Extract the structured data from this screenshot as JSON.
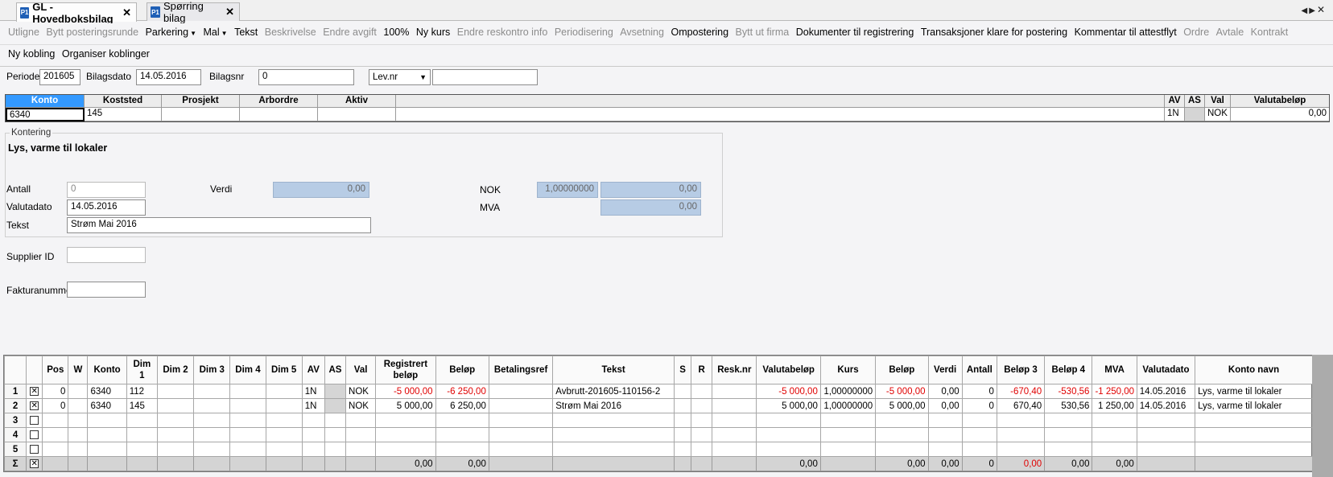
{
  "tabs": [
    {
      "label": "GL - Hovedboksbilag",
      "active": true
    },
    {
      "label": "Spørring bilag",
      "active": false
    }
  ],
  "toolbar": {
    "row1": [
      {
        "label": "Utligne",
        "enabled": false
      },
      {
        "label": "Bytt posteringsrunde",
        "enabled": false
      },
      {
        "label": "Parkering",
        "enabled": true,
        "dropdown": true
      },
      {
        "label": "Mal",
        "enabled": true,
        "dropdown": true
      },
      {
        "label": "Tekst",
        "enabled": true
      },
      {
        "label": "Beskrivelse",
        "enabled": false
      },
      {
        "label": "Endre avgift",
        "enabled": false
      },
      {
        "label": "100%",
        "enabled": true
      },
      {
        "label": "Ny kurs",
        "enabled": true
      },
      {
        "label": "Endre reskontro info",
        "enabled": false
      },
      {
        "label": "Periodisering",
        "enabled": false
      },
      {
        "label": "Avsetning",
        "enabled": false
      },
      {
        "label": "Ompostering",
        "enabled": true
      },
      {
        "label": "Bytt ut firma",
        "enabled": false
      },
      {
        "label": "Dokumenter til registrering",
        "enabled": true
      },
      {
        "label": "Transaksjoner klare for postering",
        "enabled": true
      },
      {
        "label": "Kommentar til attestflyt",
        "enabled": true
      },
      {
        "label": "Ordre",
        "enabled": false
      },
      {
        "label": "Avtale",
        "enabled": false
      },
      {
        "label": "Kontrakt",
        "enabled": false
      }
    ],
    "row2": [
      {
        "label": "Ny kobling",
        "enabled": true
      },
      {
        "label": "Organiser koblinger",
        "enabled": true
      }
    ]
  },
  "header": {
    "periode_label": "Periode",
    "periode_value": "201605",
    "bilagsdato_label": "Bilagsdato",
    "bilagsdato_value": "14.05.2016",
    "bilagsnr_label": "Bilagsnr",
    "bilagsnr_value": "0",
    "levnr_select": "Lev.nr",
    "levnr_value": ""
  },
  "posting": {
    "columns": [
      "Konto",
      "Koststed",
      "Prosjekt",
      "Arbordre",
      "Aktiv",
      "",
      "AV",
      "AS",
      "Val",
      "Valutabeløp"
    ],
    "row": [
      "6340",
      "145",
      "",
      "",
      "",
      "",
      "1N",
      "",
      "NOK",
      "0,00"
    ]
  },
  "kontering": {
    "group_title": "Kontering",
    "account_name": "Lys, varme til lokaler",
    "antall_label": "Antall",
    "antall_value": "0",
    "verdi_label": "Verdi",
    "verdi_value": "0,00",
    "nok_label": "NOK",
    "nok_rate": "1,00000000",
    "nok_value": "0,00",
    "mva_label": "MVA",
    "mva_value": "0,00",
    "valutadato_label": "Valutadato",
    "valutadato_value": "14.05.2016",
    "tekst_label": "Tekst",
    "tekst_value": "Strøm Mai 2016",
    "supplier_label": "Supplier ID",
    "supplier_value": "",
    "faktura_label": "Fakturanummer",
    "faktura_value": ""
  },
  "grid": {
    "columns": [
      "",
      "",
      "Pos",
      "W",
      "Konto",
      "Dim 1",
      "Dim 2",
      "Dim 3",
      "Dim 4",
      "Dim 5",
      "AV",
      "AS",
      "Val",
      "Registrert beløp",
      "Beløp",
      "Betalingsref",
      "Tekst",
      "S",
      "R",
      "Resk.nr",
      "Valutabeløp",
      "Kurs",
      "Beløp",
      "Verdi",
      "Antall",
      "Beløp 3",
      "Beløp 4",
      "MVA",
      "Valutadato",
      "Konto navn"
    ],
    "rows": [
      {
        "n": "1",
        "checked": true,
        "pos": "0",
        "w": "",
        "konto": "6340",
        "dim1": "112",
        "dim2": "",
        "dim3": "",
        "dim4": "",
        "dim5": "",
        "av": "1N",
        "as": "",
        "val": "NOK",
        "registrert": "-5 000,00",
        "belop": "-6 250,00",
        "betref": "",
        "tekst": "Avbrutt-201605-110156-2",
        "s": "",
        "r": "",
        "resk": "",
        "valutabelop": "-5 000,00",
        "kurs": "1,00000000",
        "belop2": "-5 000,00",
        "verdi": "0,00",
        "antall": "0",
        "belop3": "-670,40",
        "belop4": "-530,56",
        "mva": "-1 250,00",
        "valutadato": "14.05.2016",
        "kontonavn": "Lys, varme til lokaler"
      },
      {
        "n": "2",
        "checked": true,
        "pos": "0",
        "w": "",
        "konto": "6340",
        "dim1": "145",
        "dim2": "",
        "dim3": "",
        "dim4": "",
        "dim5": "",
        "av": "1N",
        "as": "",
        "val": "NOK",
        "registrert": "5 000,00",
        "belop": "6 250,00",
        "betref": "",
        "tekst": "Strøm Mai 2016",
        "s": "",
        "r": "",
        "resk": "",
        "valutabelop": "5 000,00",
        "kurs": "1,00000000",
        "belop2": "5 000,00",
        "verdi": "0,00",
        "antall": "0",
        "belop3": "670,40",
        "belop4": "530,56",
        "mva": "1 250,00",
        "valutadato": "14.05.2016",
        "kontonavn": "Lys, varme til lokaler"
      },
      {
        "n": "3",
        "checked": false
      },
      {
        "n": "4",
        "checked": false
      },
      {
        "n": "5",
        "checked": false
      }
    ],
    "sum": {
      "symbol": "Σ",
      "registrert": "0,00",
      "belop": "0,00",
      "valutabelop": "0,00",
      "belop2": "0,00",
      "verdi": "0,00",
      "antall": "0",
      "belop3": "0,00",
      "belop4": "0,00",
      "mva": "0,00"
    }
  }
}
